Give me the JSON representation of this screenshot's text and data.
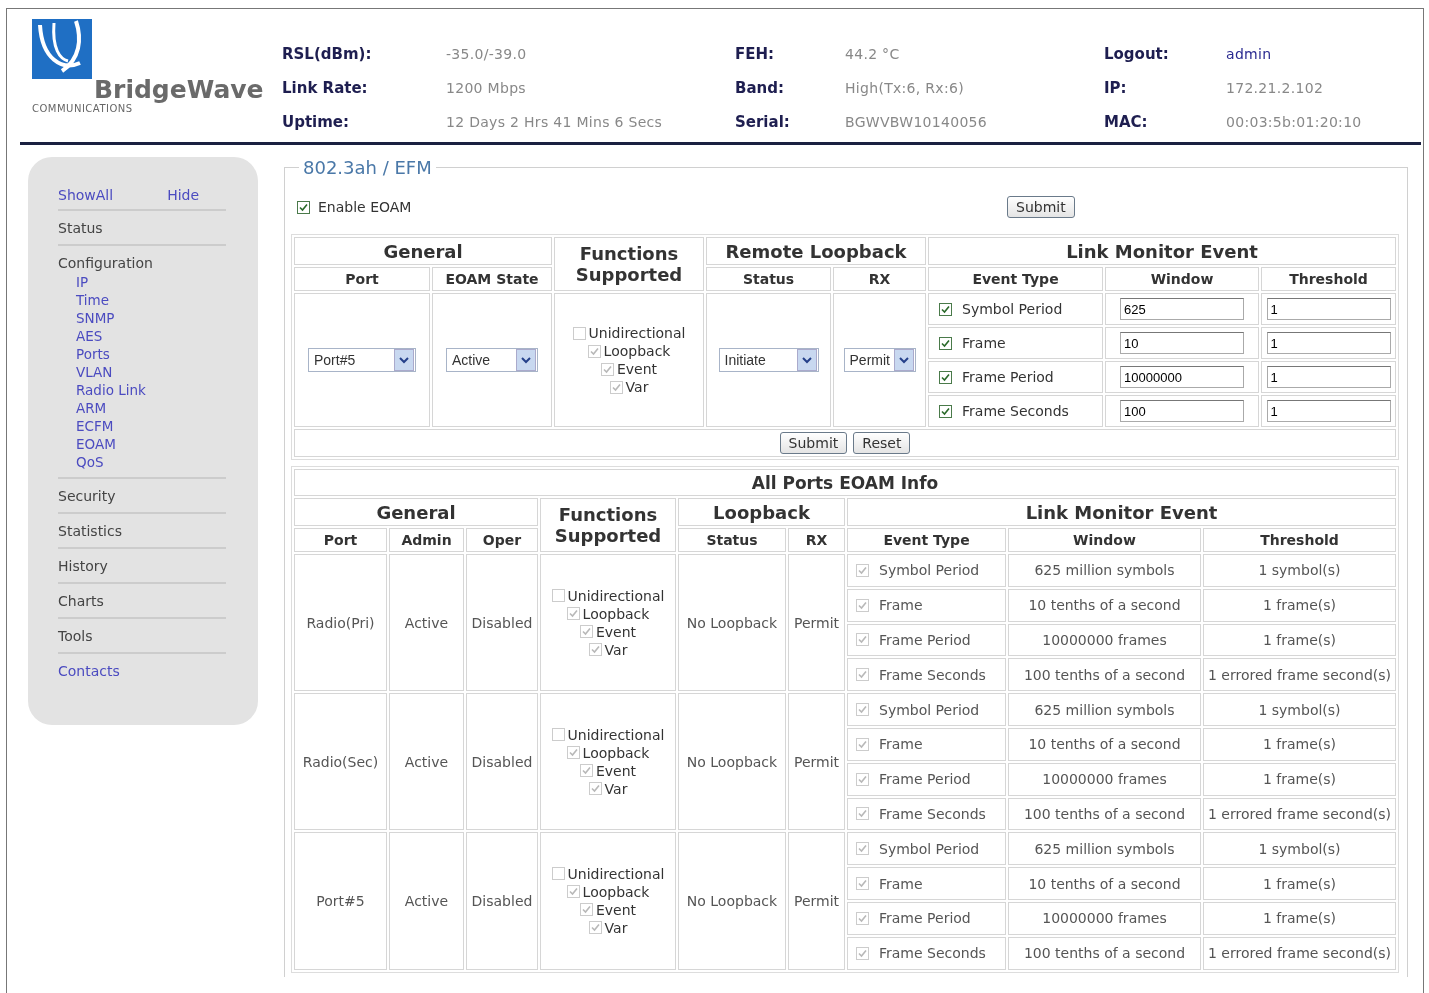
{
  "header": {
    "logo": {
      "name": "BridgeWave",
      "tagline": "COMMUNICATIONS"
    },
    "columns": [
      [
        {
          "label": "RSL(dBm):",
          "value": "-35.0/-39.0",
          "kind": "text"
        },
        {
          "label": "Link Rate:",
          "value": "1200 Mbps",
          "kind": "text"
        },
        {
          "label": "Uptime:",
          "value": "12 Days 2 Hrs 41 Mins 6 Secs",
          "kind": "text"
        }
      ],
      [
        {
          "label": "FEH:",
          "value": "44.2 °C",
          "kind": "text"
        },
        {
          "label": "Band:",
          "value": "High(Tx:6, Rx:6)",
          "kind": "text"
        },
        {
          "label": "Serial:",
          "value": "BGWVBW10140056",
          "kind": "text"
        }
      ],
      [
        {
          "label": "Logout:",
          "value": "admin",
          "kind": "link"
        },
        {
          "label": "IP:",
          "value": "172.21.2.102",
          "kind": "text"
        },
        {
          "label": "MAC:",
          "value": "00:03:5b:01:20:10",
          "kind": "text"
        }
      ]
    ]
  },
  "sidebar": {
    "toggles": [
      "ShowAll",
      "Hide"
    ],
    "sections": [
      {
        "label": "Status",
        "kind": "heading"
      },
      {
        "label": "Configuration",
        "kind": "heading",
        "children": [
          {
            "label": "IP"
          },
          {
            "label": "Time"
          },
          {
            "label": "SNMP"
          },
          {
            "label": "AES"
          },
          {
            "label": "Ports"
          },
          {
            "label": "VLAN"
          },
          {
            "label": "Radio Link"
          },
          {
            "label": "ARM"
          },
          {
            "label": "ECFM"
          },
          {
            "label": "EOAM"
          },
          {
            "label": "QoS"
          }
        ]
      },
      {
        "label": "Security",
        "kind": "heading"
      },
      {
        "label": "Statistics",
        "kind": "heading"
      },
      {
        "label": "History",
        "kind": "heading"
      },
      {
        "label": "Charts",
        "kind": "heading"
      },
      {
        "label": "Tools",
        "kind": "heading"
      },
      {
        "label": "Contacts",
        "kind": "link"
      }
    ]
  },
  "panel": {
    "legend": "802.3ah / EFM",
    "enable_eoam": {
      "label": "Enable EOAM",
      "checked": true
    },
    "submit_button": "Submit",
    "config_table": {
      "headers": {
        "general": "General",
        "port": "Port",
        "eoam_state": "EOAM State",
        "functions": "Functions Supported",
        "remote_loopback": "Remote Loopback",
        "status": "Status",
        "rx": "RX",
        "link_monitor_event": "Link Monitor Event",
        "event_type": "Event Type",
        "window": "Window",
        "threshold": "Threshold"
      },
      "port": "Port#5",
      "eoam_state": "Active",
      "functions": [
        {
          "label": "Unidirectional",
          "checked": false,
          "disabled": true
        },
        {
          "label": "Loopback",
          "checked": true,
          "disabled": true
        },
        {
          "label": "Event",
          "checked": true,
          "disabled": true
        },
        {
          "label": "Var",
          "checked": true,
          "disabled": true
        }
      ],
      "status": "Initiate",
      "rx": "Permit",
      "events": [
        {
          "label": "Symbol Period",
          "checked": true,
          "disabled": false,
          "window": "625",
          "threshold": "1"
        },
        {
          "label": "Frame",
          "checked": true,
          "disabled": false,
          "window": "10",
          "threshold": "1"
        },
        {
          "label": "Frame Period",
          "checked": true,
          "disabled": false,
          "window": "10000000",
          "threshold": "1"
        },
        {
          "label": "Frame Seconds",
          "checked": true,
          "disabled": false,
          "window": "100",
          "threshold": "1"
        }
      ],
      "buttons": [
        "Submit",
        "Reset"
      ]
    },
    "info_table": {
      "title": "All Ports EOAM Info",
      "headers": {
        "general": "General",
        "port": "Port",
        "admin": "Admin",
        "oper": "Oper",
        "functions": "Functions Supported",
        "loopback": "Loopback",
        "status": "Status",
        "rx": "RX",
        "link_monitor_event": "Link Monitor Event",
        "event_type": "Event Type",
        "window": "Window",
        "threshold": "Threshold"
      },
      "rows": [
        {
          "port": "Radio(Pri)",
          "admin": "Active",
          "oper": "Disabled",
          "functions": [
            {
              "label": "Unidirectional",
              "checked": false,
              "disabled": true
            },
            {
              "label": "Loopback",
              "checked": true,
              "disabled": true
            },
            {
              "label": "Event",
              "checked": true,
              "disabled": true
            },
            {
              "label": "Var",
              "checked": true,
              "disabled": true
            }
          ],
          "loopback_status": "No Loopback",
          "rx": "Permit",
          "events": [
            {
              "label": "Symbol Period",
              "checked": true,
              "disabled": true,
              "window": "625 million symbols",
              "threshold": "1 symbol(s)"
            },
            {
              "label": "Frame",
              "checked": true,
              "disabled": true,
              "window": "10 tenths of a second",
              "threshold": "1 frame(s)"
            },
            {
              "label": "Frame Period",
              "checked": true,
              "disabled": true,
              "window": "10000000 frames",
              "threshold": "1 frame(s)"
            },
            {
              "label": "Frame Seconds",
              "checked": true,
              "disabled": true,
              "window": "100 tenths of a second",
              "threshold": "1 errored frame second(s)"
            }
          ]
        },
        {
          "port": "Radio(Sec)",
          "admin": "Active",
          "oper": "Disabled",
          "functions": [
            {
              "label": "Unidirectional",
              "checked": false,
              "disabled": true
            },
            {
              "label": "Loopback",
              "checked": true,
              "disabled": true
            },
            {
              "label": "Event",
              "checked": true,
              "disabled": true
            },
            {
              "label": "Var",
              "checked": true,
              "disabled": true
            }
          ],
          "loopback_status": "No Loopback",
          "rx": "Permit",
          "events": [
            {
              "label": "Symbol Period",
              "checked": true,
              "disabled": true,
              "window": "625 million symbols",
              "threshold": "1 symbol(s)"
            },
            {
              "label": "Frame",
              "checked": true,
              "disabled": true,
              "window": "10 tenths of a second",
              "threshold": "1 frame(s)"
            },
            {
              "label": "Frame Period",
              "checked": true,
              "disabled": true,
              "window": "10000000 frames",
              "threshold": "1 frame(s)"
            },
            {
              "label": "Frame Seconds",
              "checked": true,
              "disabled": true,
              "window": "100 tenths of a second",
              "threshold": "1 errored frame second(s)"
            }
          ]
        },
        {
          "port": "Port#5",
          "admin": "Active",
          "oper": "Disabled",
          "functions": [
            {
              "label": "Unidirectional",
              "checked": false,
              "disabled": true
            },
            {
              "label": "Loopback",
              "checked": true,
              "disabled": true
            },
            {
              "label": "Event",
              "checked": true,
              "disabled": true
            },
            {
              "label": "Var",
              "checked": true,
              "disabled": true
            }
          ],
          "loopback_status": "No Loopback",
          "rx": "Permit",
          "events": [
            {
              "label": "Symbol Period",
              "checked": true,
              "disabled": true,
              "window": "625 million symbols",
              "threshold": "1 symbol(s)"
            },
            {
              "label": "Frame",
              "checked": true,
              "disabled": true,
              "window": "10 tenths of a second",
              "threshold": "1 frame(s)"
            },
            {
              "label": "Frame Period",
              "checked": true,
              "disabled": true,
              "window": "10000000 frames",
              "threshold": "1 frame(s)"
            },
            {
              "label": "Frame Seconds",
              "checked": true,
              "disabled": true,
              "window": "100 tenths of a second",
              "threshold": "1 errored frame second(s)"
            }
          ]
        }
      ]
    }
  }
}
